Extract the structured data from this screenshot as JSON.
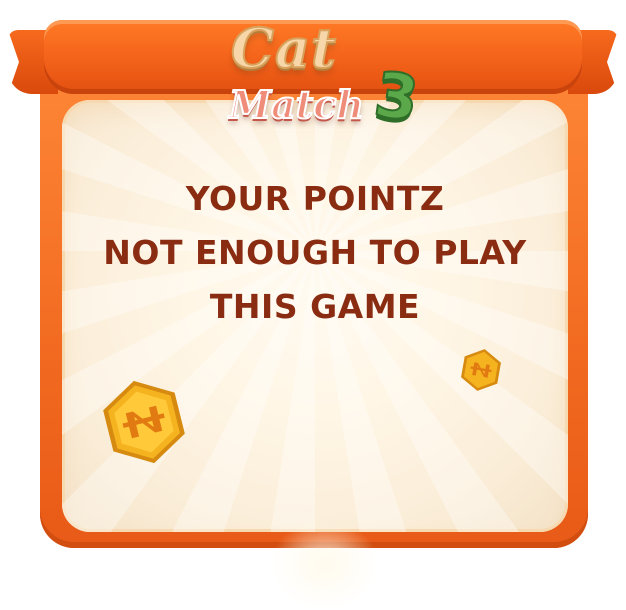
{
  "logo": {
    "line1": "Cat",
    "line2": "Match",
    "number": "3"
  },
  "message": {
    "lines": [
      "YOUR POINTZ",
      "NOT ENOUGH TO PLAY",
      "THIS GAME"
    ]
  },
  "decorations": {
    "coin_icon": "coin-icon",
    "coin_color": "#f5b320",
    "coin_symbol_color": "#e27a12"
  },
  "colors": {
    "ribbon": "#f3621a",
    "panel": "#fff6e6",
    "text": "#8a2c12"
  }
}
